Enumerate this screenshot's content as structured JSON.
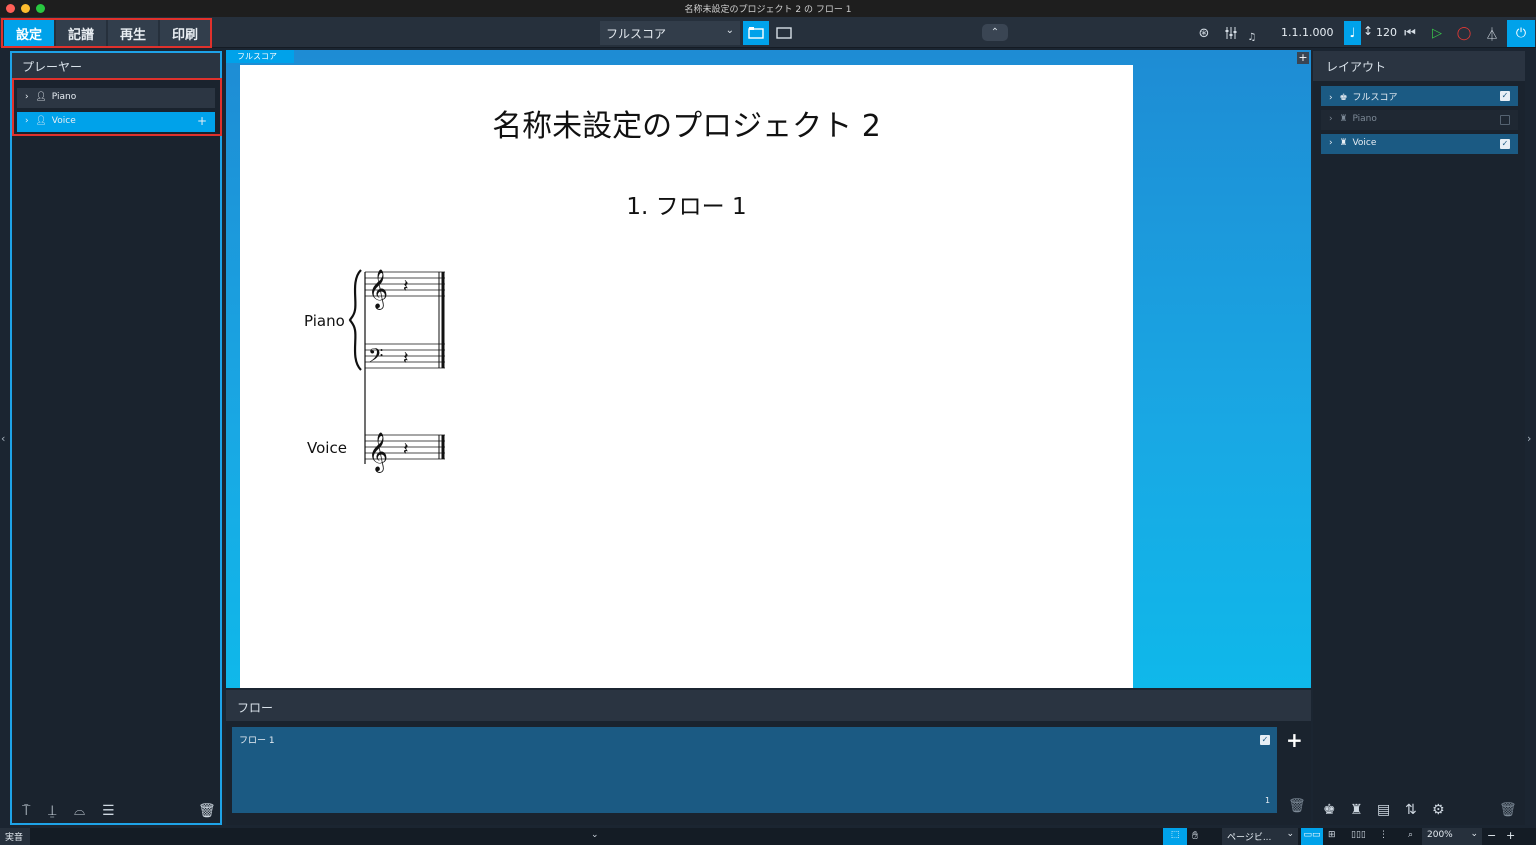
{
  "window": {
    "title": "名称未設定のプロジェクト 2 の フロー 1"
  },
  "toolbar": {
    "modes": [
      "設定",
      "記譜",
      "再生",
      "印刷"
    ],
    "layout_select": "フルスコア",
    "position": "1.1.1.000",
    "tempo": "120"
  },
  "players_panel": {
    "title": "プレーヤー",
    "players": [
      {
        "name": "Piano",
        "selected": false
      },
      {
        "name": "Voice",
        "selected": true
      }
    ]
  },
  "score": {
    "tab": "フルスコア",
    "title": "名称未設定のプロジェクト 2",
    "flow_heading": "1. フロー 1",
    "instruments": [
      "Piano",
      "Voice"
    ]
  },
  "flows_panel": {
    "title": "フロー",
    "flow": {
      "name": "フロー 1",
      "number": "1"
    }
  },
  "layouts_panel": {
    "title": "レイアウト",
    "layouts": [
      {
        "name": "フルスコア",
        "checked": true
      },
      {
        "name": "Piano",
        "checked": false
      },
      {
        "name": "Voice",
        "checked": true
      }
    ]
  },
  "statusbar": {
    "mode": "実音",
    "view": "ページビ...",
    "zoom": "200%"
  },
  "colors": {
    "accent": "#00a2ea",
    "highlight_box": "#e0312c"
  }
}
